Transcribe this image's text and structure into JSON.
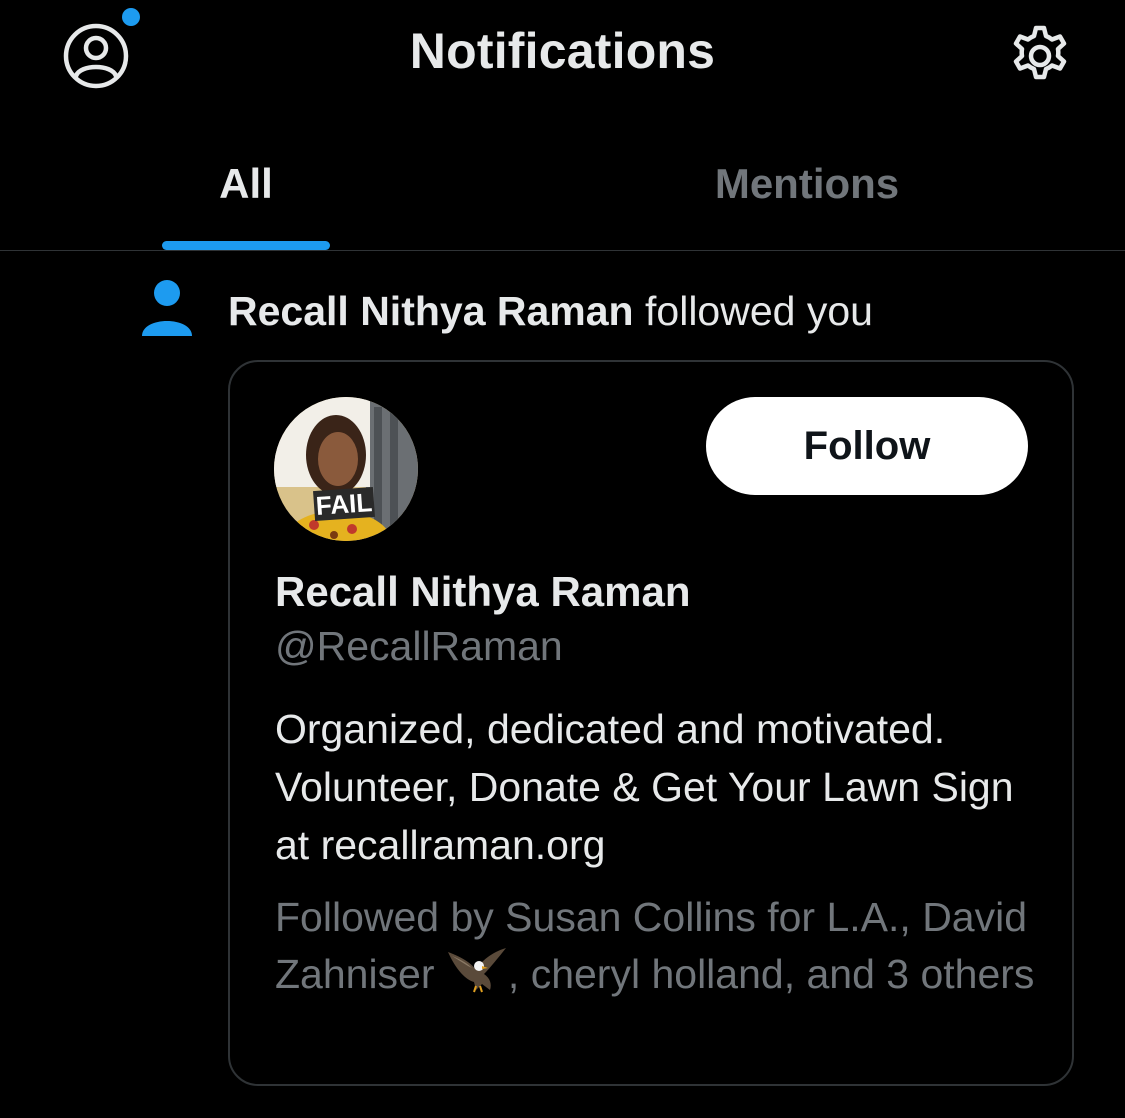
{
  "header": {
    "title": "Notifications",
    "profile_icon": "profile-circle-icon",
    "settings_icon": "gear-icon",
    "has_unread_dot": true
  },
  "tabs": [
    {
      "label": "All",
      "selected": true
    },
    {
      "label": "Mentions",
      "selected": false
    }
  ],
  "notification": {
    "icon": "person-icon",
    "actor": "Recall Nithya Raman",
    "action": "followed you"
  },
  "card": {
    "avatar_text": "FAIL",
    "follow_label": "Follow",
    "name": "Recall Nithya Raman",
    "handle": "@RecallRaman",
    "bio": "Organized, dedicated and motivated. Volunteer, Donate & Get Your Lawn Sign at recallraman.org",
    "followed_by_prefix": "Followed by Susan Collins for L.A., David Zahniser",
    "followed_by_emoji": "eagle-emoji",
    "followed_by_suffix": ", cheryl holland, and 3 others"
  },
  "colors": {
    "background": "#000000",
    "accent": "#1d9bf0",
    "primary_text": "#e7e9ea",
    "secondary_text": "#71767b",
    "border": "#2f3336"
  }
}
